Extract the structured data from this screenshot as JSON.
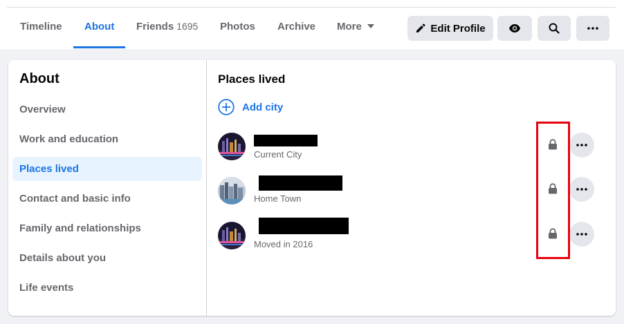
{
  "tabs": [
    {
      "label": "Timeline"
    },
    {
      "label": "About"
    },
    {
      "label": "Friends",
      "count": "1695"
    },
    {
      "label": "Photos"
    },
    {
      "label": "Archive"
    },
    {
      "label": "More"
    }
  ],
  "active_tab": "About",
  "actions": {
    "edit_profile_label": "Edit Profile",
    "icons": [
      "pencil-icon",
      "eye-icon",
      "search-icon",
      "more-horizontal-icon"
    ]
  },
  "sidebar": {
    "title": "About",
    "items": [
      {
        "label": "Overview"
      },
      {
        "label": "Work and education"
      },
      {
        "label": "Places lived"
      },
      {
        "label": "Contact and basic info"
      },
      {
        "label": "Family and relationships"
      },
      {
        "label": "Details about you"
      },
      {
        "label": "Life events"
      }
    ],
    "active_item": "Places lived"
  },
  "main": {
    "section_title": "Places lived",
    "add_city_label": "Add city",
    "places": [
      {
        "subtitle": "Current City",
        "name_redacted": true,
        "privacy_icon": "lock-icon",
        "thumbnail": "city-night-skyline"
      },
      {
        "subtitle": "Home Town",
        "name_redacted": true,
        "privacy_icon": "lock-icon",
        "thumbnail": "city-day-skyline"
      },
      {
        "subtitle": "Moved in 2016",
        "name_redacted": true,
        "privacy_icon": "lock-icon",
        "thumbnail": "city-night-skyline"
      }
    ]
  },
  "colors": {
    "accent": "#1b74e4",
    "highlight_box": "#e8000b",
    "background": "#f0f2f5"
  }
}
